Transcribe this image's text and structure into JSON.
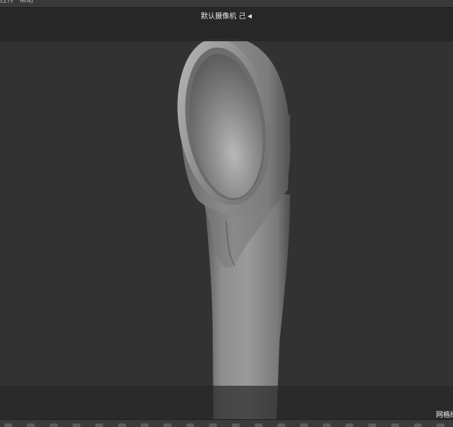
{
  "menubar": {
    "items": [
      {
        "label": "控件"
      },
      {
        "label": "帮助"
      }
    ]
  },
  "viewport": {
    "camera_label": "默认摄像机 己",
    "mesh_label": "网格绘"
  },
  "colors": {
    "background": "#323232",
    "letterbox": "#262626",
    "model": "#8a8a8a"
  },
  "icons": {
    "camera": "camera-icon"
  },
  "shelf": {
    "icon_count": 20
  }
}
